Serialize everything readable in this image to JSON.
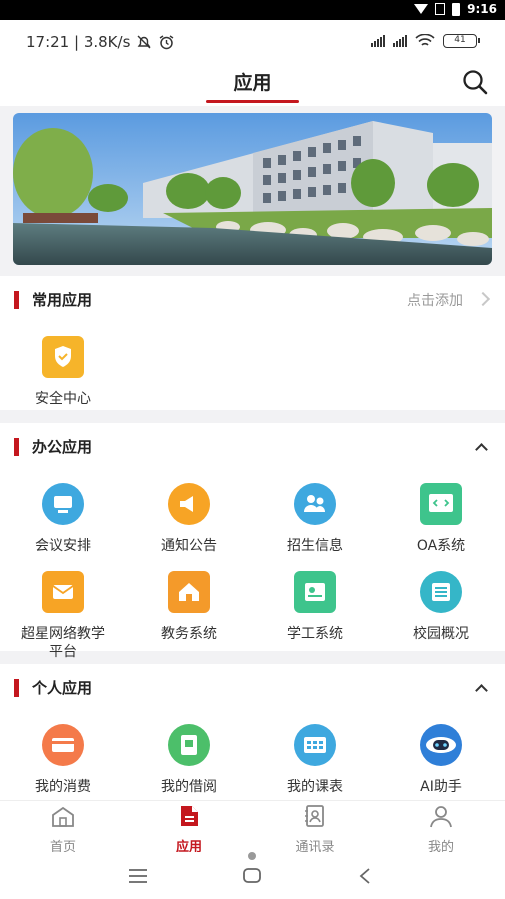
{
  "system_bar": {
    "time": "9:16"
  },
  "status": {
    "time_speed": "17:21 | 3.8K/s",
    "battery": "41"
  },
  "header": {
    "title": "应用"
  },
  "common": {
    "title": "常用应用",
    "add_label": "点击添加",
    "items": [
      {
        "label": "安全中心",
        "icon": "shield-icon",
        "color": "#f6b42a"
      }
    ]
  },
  "office": {
    "title": "办公应用",
    "items": [
      {
        "label": "会议安排",
        "icon": "meeting-icon",
        "color": "#3ea8df"
      },
      {
        "label": "通知公告",
        "icon": "megaphone-icon",
        "color": "#f7a425"
      },
      {
        "label": "招生信息",
        "icon": "users-icon",
        "color": "#3ea8df"
      },
      {
        "label": "OA系统",
        "icon": "code-window-icon",
        "color": "#3ec48c"
      },
      {
        "label": "超星网络教学\n平台",
        "icon": "envelope-icon",
        "color": "#f7a425"
      },
      {
        "label": "教务系统",
        "icon": "home-icon",
        "color": "#f49a2a"
      },
      {
        "label": "学工系统",
        "icon": "id-card-icon",
        "color": "#3ec48c"
      },
      {
        "label": "校园概况",
        "icon": "list-icon",
        "color": "#35b6c8"
      }
    ]
  },
  "personal": {
    "title": "个人应用",
    "items": [
      {
        "label": "我的消费",
        "icon": "card-icon",
        "color": "#f47a4a"
      },
      {
        "label": "我的借阅",
        "icon": "book-icon",
        "color": "#4cbf6a"
      },
      {
        "label": "我的课表",
        "icon": "schedule-icon",
        "color": "#3ea8df"
      },
      {
        "label": "AI助手",
        "icon": "robot-icon",
        "color": "#2f7fd8"
      }
    ]
  },
  "tabbar": {
    "items": [
      {
        "label": "首页",
        "icon": "home-tab-icon",
        "active": false
      },
      {
        "label": "应用",
        "icon": "apps-tab-icon",
        "active": true
      },
      {
        "label": "通讯录",
        "icon": "contacts-tab-icon",
        "active": false
      },
      {
        "label": "我的",
        "icon": "profile-tab-icon",
        "active": false
      }
    ]
  },
  "colors": {
    "accent": "#c4171e",
    "background": "#f2f2f4"
  }
}
